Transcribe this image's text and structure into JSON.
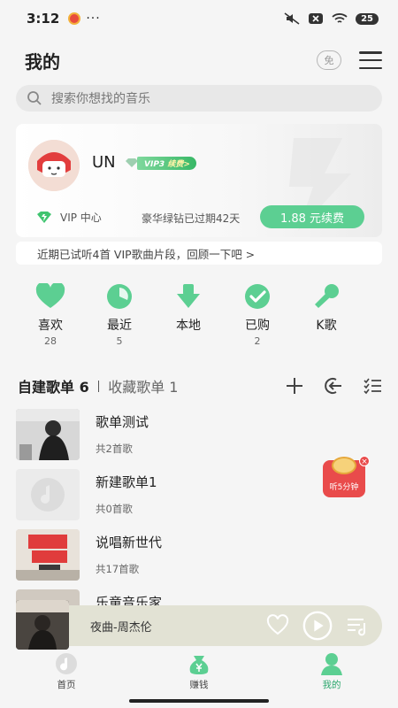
{
  "status_bar": {
    "time": "3:12",
    "more": "···",
    "battery": "25"
  },
  "header": {
    "title": "我的",
    "free_badge": "免"
  },
  "search": {
    "placeholder": "搜索你想找的音乐"
  },
  "vip_card": {
    "username": "UN",
    "vip_level": "VIP3",
    "vip_renew": "续费>",
    "vip_center": "VIP 中心",
    "expired_text": "豪华绿钻已过期42天",
    "renew_button": "1.88 元续费"
  },
  "tip": {
    "text": "近期已试听4首 VIP歌曲片段，回顾一下吧 >"
  },
  "quick_actions": [
    {
      "icon": "heart-icon",
      "label": "喜欢",
      "count": "28"
    },
    {
      "icon": "clock-icon",
      "label": "最近",
      "count": "5"
    },
    {
      "icon": "download-icon",
      "label": "本地",
      "count": ""
    },
    {
      "icon": "check-icon",
      "label": "已购",
      "count": "2"
    },
    {
      "icon": "microphone-icon",
      "label": "K歌",
      "count": ""
    }
  ],
  "playlists_header": {
    "own_tab": "自建歌单 6",
    "fav_tab": "收藏歌单 1"
  },
  "playlists": [
    {
      "name": "歌单测试",
      "count": "共2首歌"
    },
    {
      "name": "新建歌单1",
      "count": "共0首歌"
    },
    {
      "name": "说唱新世代",
      "count": "共17首歌"
    },
    {
      "name": "乐童音乐家",
      "count": ""
    }
  ],
  "float_reward": {
    "label": "听5分钟",
    "close": "×"
  },
  "player": {
    "song": "夜曲-周杰伦"
  },
  "tabbar": [
    {
      "label": "首页"
    },
    {
      "label": "赚钱"
    },
    {
      "label": "我的"
    }
  ],
  "colors": {
    "accent": "#5ccf92",
    "active_tab": "#2da86e",
    "reward_red": "#e94b4b"
  }
}
